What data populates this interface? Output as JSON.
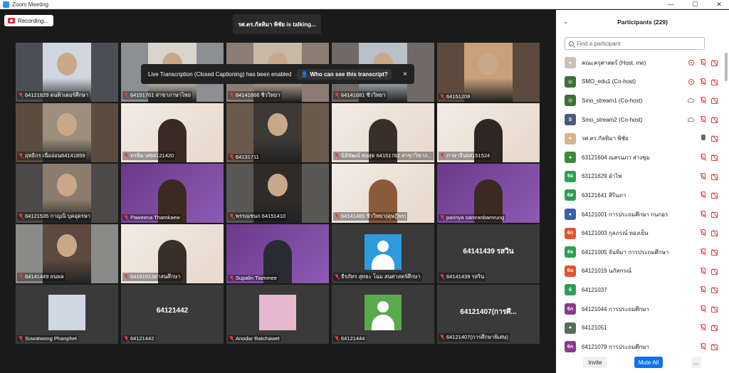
{
  "window": {
    "title": "Zoom Meeting",
    "controls": [
      "—",
      "☐",
      "✕"
    ]
  },
  "recording": {
    "label": "Recording..."
  },
  "talking": {
    "text": "รศ.ดร.กัลทิมา พิชัย is talking..."
  },
  "toast": {
    "message": "Live Transcription (Closed Captioning) has been enabled",
    "link": "Who can see this transcript?",
    "close": "×"
  },
  "tiles": [
    {
      "label": "64121829 ดนพิวเตอร์ศึกษา",
      "type": "video",
      "bg": "#4a4f55",
      "photo": "#cfd6df"
    },
    {
      "label": "64151761 สาขาภาษาไทย",
      "type": "video",
      "bg": "#8d8f93",
      "photo": "#d9d4cc"
    },
    {
      "label": "64141666 ชีววิทยา",
      "type": "video",
      "bg": "#8b7d73",
      "photo": "#c8b8a6"
    },
    {
      "label": "64141681 ชีววิทยา",
      "type": "video",
      "bg": "#6f6a66",
      "photo": "#b9c0c7"
    },
    {
      "label": "64151208",
      "type": "video",
      "bg": "#5b4a3d",
      "photo": "#c9a07a"
    },
    {
      "label": "ฤทธิกร เนื่ออ่อน64141859",
      "type": "video",
      "bg": "#5a4d3f",
      "photo": "#9c8f7d"
    },
    {
      "label": "พรพิมาศ64121420",
      "type": "banner",
      "bg": "#efe7de",
      "photo": "#3b2a24"
    },
    {
      "label": "64131711",
      "type": "video",
      "bg": "#6a5a4c",
      "photo": "#3d3a36"
    },
    {
      "label": "นิธิพัฒน์ หอสุด 64151782 สาขาวิชาภ...",
      "type": "banner",
      "bg": "#e9dfd5",
      "photo": "#3a2e28"
    },
    {
      "label": "ภาษาจีน64151524",
      "type": "banner",
      "bg": "#efe7de",
      "photo": "#2e2622"
    },
    {
      "label": "64121535 กาญณิ บุคอุดรษา",
      "type": "video",
      "bg": "#4c4a48",
      "photo": "#8b7d6e"
    },
    {
      "label": "Paweena Thamkaew",
      "type": "purple",
      "bg": "#7a4a9c",
      "photo": "#3a2a22"
    },
    {
      "label": "พรรณชนก 64151410",
      "type": "video",
      "bg": "#5a5855",
      "photo": "#2f2b28"
    },
    {
      "label": "64141485 ชีววิทยา(ดุษฎีพร)",
      "type": "banner",
      "bg": "#efe7de",
      "photo": "#8a5a3a"
    },
    {
      "label": "parinya samranbamrung",
      "type": "purple",
      "bg": "#7a4a9c",
      "photo": "#3a2a22"
    },
    {
      "label": "64141449 ธนพล",
      "type": "video",
      "bg": "#8a8a88",
      "photo": "#5c4a3e"
    },
    {
      "label": "64161513ศาสนศึกษา",
      "type": "banner",
      "bg": "#efe7de",
      "photo": "#3a2e28"
    },
    {
      "label": "Supalin Tiammee",
      "type": "purple",
      "bg": "#6e3e92",
      "photo": "#2a2a34"
    },
    {
      "label": "ธีรภัทร สุทธะ โฉม สนศาสตร์ศึกษา",
      "type": "avatar",
      "bg": "#3a3a3a",
      "color": "blue"
    },
    {
      "label": "64141439 รสริน",
      "type": "name",
      "bg": "#3a3a3a",
      "name": "64141439 รสวิน"
    },
    {
      "label": "Suwatwong Phanphet",
      "type": "photo",
      "bg": "#3a3a3a",
      "photo": "#cfd8e2"
    },
    {
      "label": "64121442",
      "type": "name",
      "bg": "#3a3a3a",
      "name": "64121442"
    },
    {
      "label": "Anodar Ratchawet",
      "type": "photo",
      "bg": "#3a3a3a",
      "photo": "#e6b8d0"
    },
    {
      "label": "64121444",
      "type": "avatar",
      "bg": "#3a3a3a",
      "color": "green"
    },
    {
      "label": "64121407(การศึกษาพิเศษ)",
      "type": "name",
      "bg": "#3a3a3a",
      "name": "64121407(การศึ..."
    }
  ],
  "participants": {
    "title": "Participants (229)",
    "search_placeholder": "Find a participant",
    "list": [
      {
        "name": "คณะครุศาสตร์ (Host, me)",
        "avatar": "●",
        "color": "#c9c0b6",
        "rec": true,
        "mic": "off",
        "cam": "off"
      },
      {
        "name": "SMO_edu1 (Co-host)",
        "avatar": "◎",
        "color": "#3f6e3a",
        "rec": true,
        "mic": "off",
        "cam": "off"
      },
      {
        "name": "Smo_stream1 (Co-host)",
        "avatar": "◎",
        "color": "#3f6e3a",
        "cloud": true,
        "mic": "off",
        "cam": "off"
      },
      {
        "name": "Smo_stream2 (Co-host)",
        "avatar": "S",
        "color": "#4a5a7a",
        "cloud": true,
        "mic": "off",
        "cam": "off"
      },
      {
        "name": "รศ.ดร.กัลทิมา พิชัย",
        "avatar": "●",
        "color": "#d9b38c",
        "mic": "on",
        "cam": "off"
      },
      {
        "name": "63121604 ณสรนภา ส่างขุม",
        "avatar": "●",
        "color": "#3f8a3a",
        "mic": "off",
        "cam": "off"
      },
      {
        "name": "63121629 อำไพ",
        "avatar": "6อ",
        "color": "#2e9e55",
        "mic": "off",
        "cam": "off"
      },
      {
        "name": "63121641 สิรินภา",
        "avatar": "6ส",
        "color": "#2e9e55",
        "mic": "off",
        "cam": "off"
      },
      {
        "name": "64121001 การประถมศึกษา กนกอร",
        "avatar": "●",
        "color": "#3a5fa8",
        "mic": "off",
        "cam": "off"
      },
      {
        "name": "64121003 กุลภรณ์ ทองเย็น",
        "avatar": "6ก",
        "color": "#e0552b",
        "mic": "off",
        "cam": "off"
      },
      {
        "name": "64121005 จันทิมา การประถมศึกษา",
        "avatar": "6จ",
        "color": "#2e9e55",
        "mic": "off",
        "cam": "off"
      },
      {
        "name": "64121019 นภัสกรณ์",
        "avatar": "6น",
        "color": "#e0552b",
        "mic": "off",
        "cam": "off"
      },
      {
        "name": "64121037",
        "avatar": "6",
        "color": "#2e9e55",
        "mic": "off",
        "cam": "off"
      },
      {
        "name": "64121044 การประถมศึกษา",
        "avatar": "6ก",
        "color": "#8a3a8a",
        "mic": "off",
        "cam": "off"
      },
      {
        "name": "64121051",
        "avatar": "●",
        "color": "#5a6a5a",
        "mic": "off",
        "cam": "off"
      },
      {
        "name": "64121079 การประถมศึกษา",
        "avatar": "6ก",
        "color": "#8a3a8a",
        "mic": "off",
        "cam": "off"
      }
    ],
    "buttons": {
      "invite": "Invite",
      "mute_all": "Mute All",
      "more": "..."
    }
  }
}
